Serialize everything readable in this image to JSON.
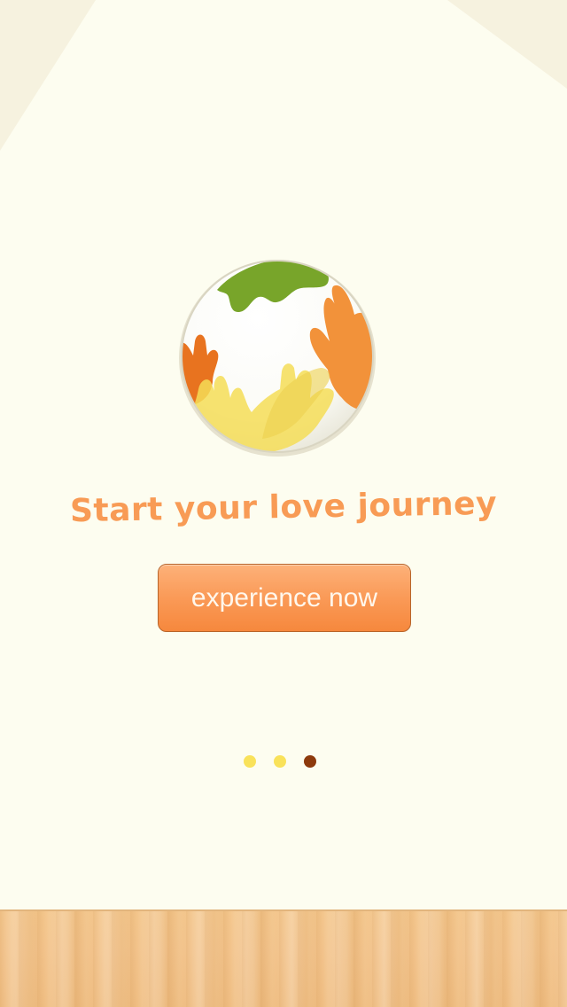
{
  "onboarding": {
    "tagline": "Start your love journey",
    "cta_label": "experience now",
    "pager": {
      "total": 3,
      "active_index": 2
    }
  },
  "colors": {
    "background": "#fdfdf0",
    "accent_orange": "#f89b55",
    "button_orange": "#fa9a57",
    "dot_inactive": "#f9e25a",
    "dot_active": "#8d3a0c",
    "floor_wood": "#f2c28a"
  },
  "icons": {
    "logo": "hands-globe-icon"
  }
}
